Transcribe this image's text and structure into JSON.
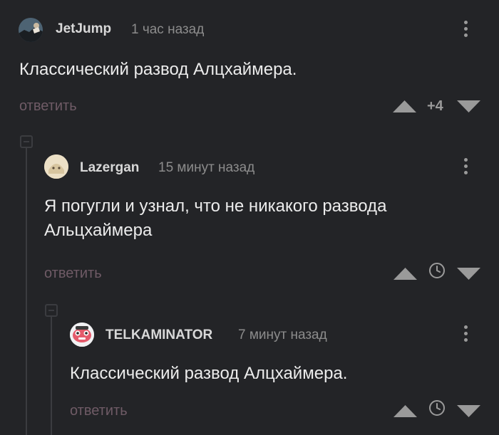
{
  "comments": [
    {
      "author": "JetJump",
      "time": "1 час назад",
      "text": "Классический развод Алцхаймера.",
      "reply_label": "ответить",
      "rating": "+4"
    },
    {
      "author": "Lazergan",
      "time": "15 минут назад",
      "text": "Я погугли и узнал, что не никакого развода Альцхаймера",
      "reply_label": "ответить"
    },
    {
      "author": "TELKAMINATOR",
      "time": "7 минут назад",
      "text": "Классический развод Алцхаймера.",
      "reply_label": "ответить"
    }
  ],
  "icons": {
    "upvote": "triangle-up-icon",
    "downvote": "triangle-down-icon",
    "more": "kebab-menu-icon",
    "pending": "clock-icon",
    "collapse": "collapse-minus-icon"
  },
  "colors": {
    "background": "#232427",
    "reply": "#6f5b66",
    "author": "#d8d8d8",
    "time": "#8c8c8c",
    "text": "#ececec"
  }
}
